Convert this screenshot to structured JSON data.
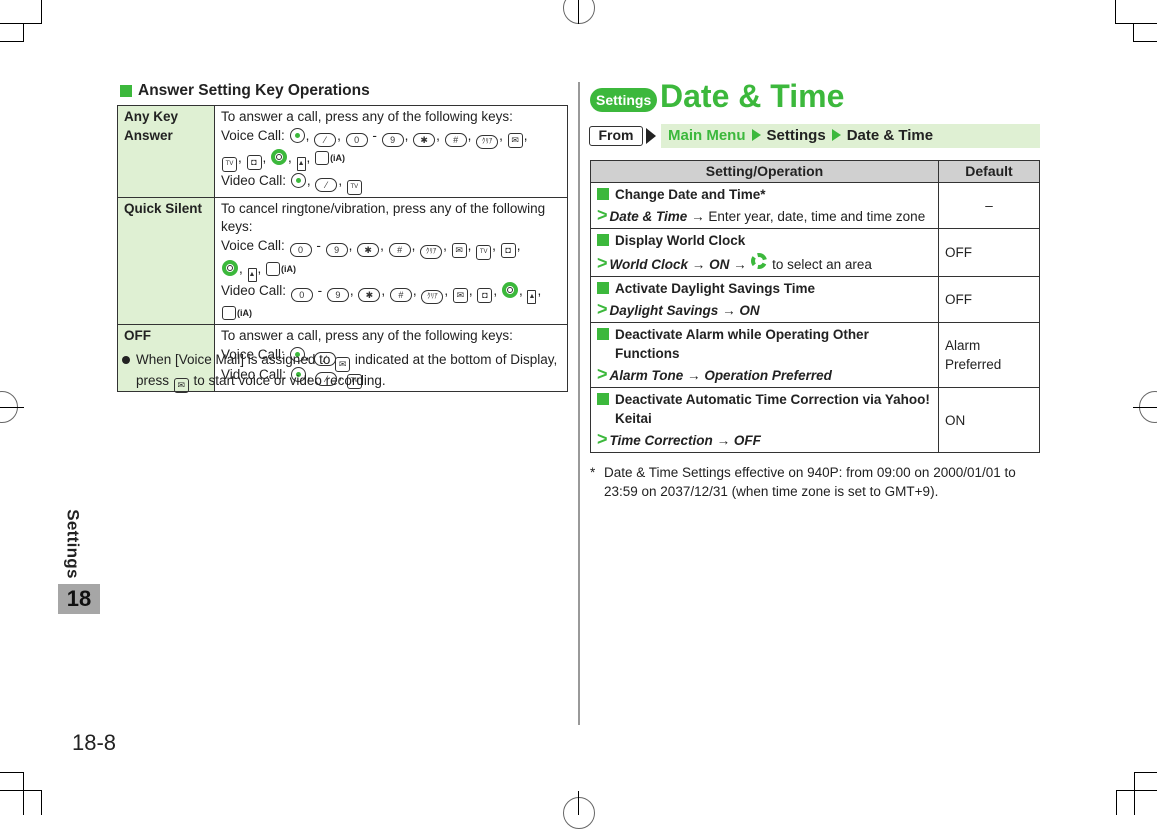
{
  "sidebar": {
    "chapter_label": "Settings",
    "chapter_number": "18"
  },
  "page_number": "18-8",
  "left": {
    "section_title": "Answer Setting Key Operations",
    "rows": [
      {
        "key": "Any Key Answer",
        "intro": "To answer a call, press any of the following keys:",
        "voice_label": "Voice Call:",
        "video_label": "Video Call:"
      },
      {
        "key": "Quick Silent",
        "intro": "To cancel ringtone/vibration, press any of the following keys:",
        "voice_label": "Voice Call:",
        "video_label": "Video Call:"
      },
      {
        "key": "OFF",
        "intro": "To answer a call, press any of the following keys:",
        "voice_label": "Voice Call:",
        "video_label": "Video Call:"
      }
    ],
    "keys": {
      "zero": "0",
      "nine": "9",
      "star": "✱",
      "hash": "#",
      "clear": "ｸﾘｱ",
      "dash": "-",
      "ia": "(iA)",
      "tv": "TV",
      "small": "▲"
    },
    "note_part1": "When [Voice Mail] is assigned to",
    "note_part2": "indicated at the bottom of Display, press",
    "note_part3": "to start voice or video recording."
  },
  "right": {
    "badge": "Settings",
    "title": "Date & Time",
    "from_label": "From",
    "breadcrumb": [
      "Main Menu",
      "Settings",
      "Date & Time"
    ],
    "table_headers": [
      "Setting/Operation",
      "Default"
    ],
    "rows": [
      {
        "title": "Change Date and Time*",
        "op_italic": "Date & Time",
        "op_rest": "Enter year, date, time and time zone",
        "default": "–"
      },
      {
        "title": "Display World Clock",
        "op_italic": "World Clock",
        "op_italic2": "ON",
        "op_rest": "to select an area",
        "default": "OFF"
      },
      {
        "title": "Activate Daylight Savings Time",
        "op_italic": "Daylight Savings",
        "op_italic2": "ON",
        "default": "OFF"
      },
      {
        "title": "Deactivate Alarm while Operating Other Functions",
        "op_italic": "Alarm Tone",
        "op_italic2": "Operation Preferred",
        "default": "Alarm Preferred"
      },
      {
        "title": "Deactivate Automatic Time Correction via Yahoo! Keitai",
        "op_italic": "Time Correction",
        "op_italic2": "OFF",
        "default": "ON"
      }
    ],
    "arrow": "→",
    "footnote_mark": "*",
    "footnote": "Date & Time Settings effective on 940P: from 09:00 on 2000/01/01 to 23:59 on 2037/12/31 (when time zone is set to GMT+9)."
  },
  "colors": {
    "accent_green": "#3cb83c",
    "light_green": "#dff0d3",
    "header_gray": "#d0d0d0",
    "badge_gray": "#a6a6a6"
  }
}
